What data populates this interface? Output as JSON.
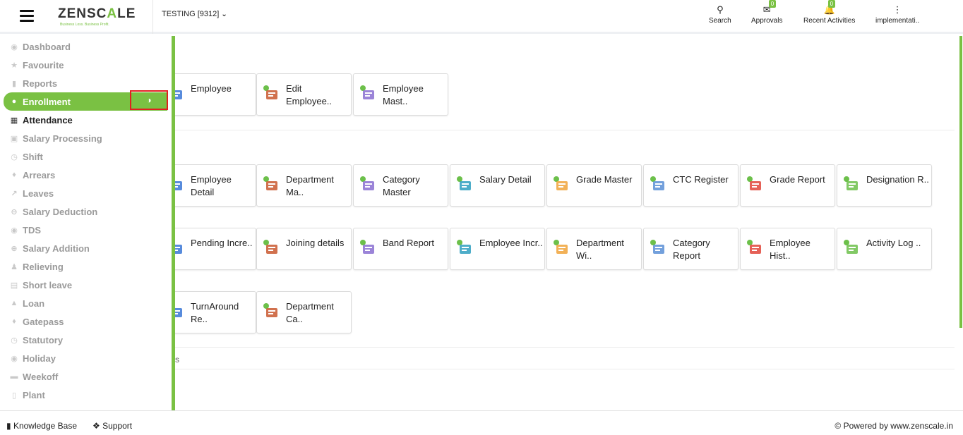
{
  "header": {
    "logo_main": "ZENSC",
    "logo_accent": "A",
    "logo_end": "LE",
    "logo_tagline": "Business Loss. Business Profit.",
    "company": "TESTING [9312]",
    "search_label": "Search",
    "approvals_label": "Approvals",
    "approvals_count": "0",
    "recent_label": "Recent Activities",
    "recent_count": "0",
    "user_label": "implementati.."
  },
  "sidebar": {
    "items": [
      {
        "label": "Dashboard",
        "icon": "dashboard-icon"
      },
      {
        "label": "Favourite",
        "icon": "star-icon"
      },
      {
        "label": "Reports",
        "icon": "file-icon"
      },
      {
        "label": "Enrollment",
        "icon": "user-icon"
      },
      {
        "label": "Attendance",
        "icon": "calendar-icon"
      },
      {
        "label": "Salary Processing",
        "icon": "money-icon"
      },
      {
        "label": "Shift",
        "icon": "clock-icon"
      },
      {
        "label": "Arrears",
        "icon": "tag-icon"
      },
      {
        "label": "Leaves",
        "icon": "external-icon"
      },
      {
        "label": "Salary Deduction",
        "icon": "minus-circle-icon"
      },
      {
        "label": "TDS",
        "icon": "drop-icon"
      },
      {
        "label": "Salary Addition",
        "icon": "plus-circle-icon"
      },
      {
        "label": "Relieving",
        "icon": "users-icon"
      },
      {
        "label": "Short leave",
        "icon": "image-icon"
      },
      {
        "label": "Loan",
        "icon": "thumb-icon"
      },
      {
        "label": "Gatepass",
        "icon": "ticket-icon"
      },
      {
        "label": "Statutory",
        "icon": "clock-icon"
      },
      {
        "label": "Holiday",
        "icon": "globe-icon"
      },
      {
        "label": "Weekoff",
        "icon": "bed-icon"
      },
      {
        "label": "Plant",
        "icon": "building-icon"
      }
    ]
  },
  "cards": {
    "row1": [
      "Employee",
      "Edit Employee..",
      "Employee Mast.."
    ],
    "row2": [
      "Employee Detail",
      "Department Ma..",
      "Category Master",
      "Salary Detail",
      "Grade Master",
      "CTC Register",
      "Grade Report",
      "Designation R.."
    ],
    "row3": [
      "Pending Incre..",
      "Joining details",
      "Band Report",
      "Employee Incr..",
      "Department Wi..",
      "Category Report",
      "Employee Hist..",
      "Activity Log .."
    ],
    "row4": [
      "TurnAround Re..",
      "Department Ca.."
    ]
  },
  "main": {
    "partial_text": "s"
  },
  "footer": {
    "knowledge": "Knowledge Base",
    "support": "Support",
    "powered": "© Powered by www.zenscale.in"
  }
}
